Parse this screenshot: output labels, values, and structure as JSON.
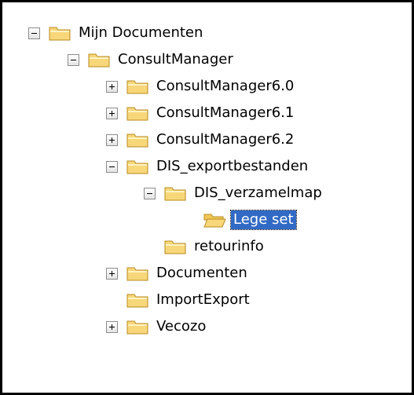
{
  "tree": {
    "nodes": [
      {
        "label": "Mijn Documenten",
        "toggle": "minus",
        "selected": false
      },
      {
        "label": "ConsultManager",
        "toggle": "minus",
        "selected": false
      },
      {
        "label": "ConsultManager6.0",
        "toggle": "plus",
        "selected": false
      },
      {
        "label": "ConsultManager6.1",
        "toggle": "plus",
        "selected": false
      },
      {
        "label": "ConsultManager6.2",
        "toggle": "plus",
        "selected": false
      },
      {
        "label": "DIS_exportbestanden",
        "toggle": "minus",
        "selected": false
      },
      {
        "label": "DIS_verzamelmap",
        "toggle": "minus",
        "selected": false
      },
      {
        "label": "Lege set",
        "toggle": "none",
        "selected": true,
        "folder_open": true
      },
      {
        "label": "retourinfo",
        "toggle": "none",
        "selected": false
      },
      {
        "label": "Documenten",
        "toggle": "plus",
        "selected": false
      },
      {
        "label": "ImportExport",
        "toggle": "none",
        "selected": false
      },
      {
        "label": "Vecozo",
        "toggle": "plus",
        "selected": false
      }
    ]
  },
  "colors": {
    "folder_fill": "#f7d77a",
    "folder_stroke": "#b98a1f",
    "selection": "#316ac5"
  },
  "icons": {
    "folder": "folder-icon",
    "expand": "expand-plus-icon",
    "collapse": "collapse-minus-icon"
  }
}
